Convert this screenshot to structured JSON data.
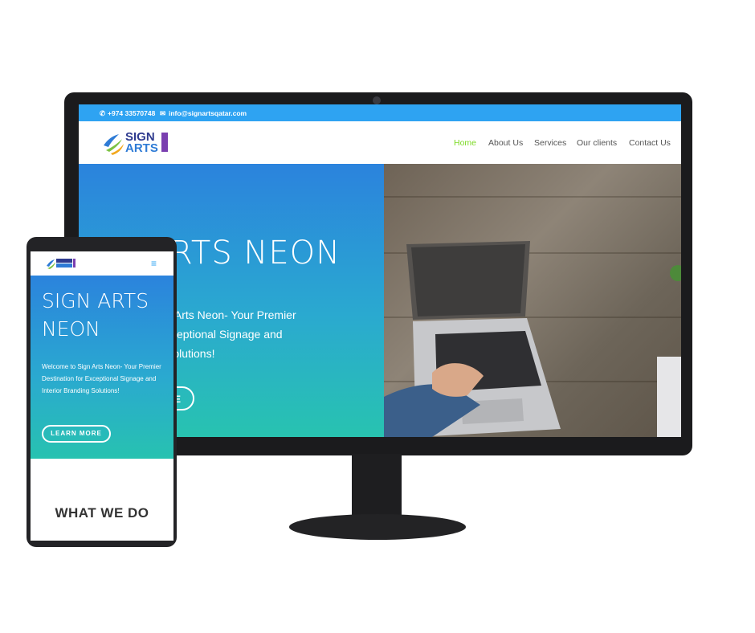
{
  "colors": {
    "accent": "#2ea3f2",
    "nav_active": "#7cda24",
    "hero_top": "#2b83dd",
    "hero_bottom": "#28c3b0"
  },
  "desktop": {
    "topbar": {
      "phone": "+974 33570748",
      "email": "info@signartsqatar.com",
      "phone_icon": "phone-icon",
      "email_icon": "envelope-icon"
    },
    "logo": {
      "line1": "SIGN",
      "line2": "ARTS"
    },
    "nav": {
      "items": [
        "Home",
        "About Us",
        "Services",
        "Our clients",
        "Contact Us"
      ],
      "active": "Home"
    },
    "hero": {
      "title": "RTS NEON",
      "text_line1": "n Arts Neon- Your Premier",
      "text_line2": "xceptional Signage and",
      "text_line3": "Solutions!",
      "button": "E"
    }
  },
  "mobile": {
    "menu_icon": "hamburger-icon",
    "hero": {
      "title": "SIGN ARTS NEON",
      "text": "Welcome to Sign Arts Neon- Your Premier Destination for Exceptional Signage and Interior Branding Solutions!",
      "button": "LEARN MORE"
    },
    "section_heading": "WHAT WE DO"
  }
}
